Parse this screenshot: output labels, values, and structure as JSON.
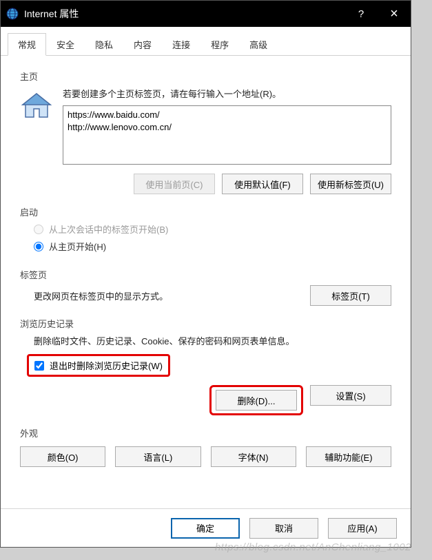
{
  "titlebar": {
    "title": "Internet 属性",
    "help": "?",
    "close": "×"
  },
  "tabs": [
    "常规",
    "安全",
    "隐私",
    "内容",
    "连接",
    "程序",
    "高级"
  ],
  "active_tab": 0,
  "homepage": {
    "label": "主页",
    "instruction": "若要创建多个主页标签页，请在每行输入一个地址(R)。",
    "urls": "https://www.baidu.com/\nhttp://www.lenovo.com.cn/",
    "btn_current": "使用当前页(C)",
    "btn_default": "使用默认值(F)",
    "btn_newtab": "使用新标签页(U)"
  },
  "startup": {
    "label": "启动",
    "opt_last": "从上次会话中的标签页开始(B)",
    "opt_home": "从主页开始(H)",
    "selected": "home"
  },
  "tabs_section": {
    "label": "标签页",
    "text": "更改网页在标签页中的显示方式。",
    "btn": "标签页(T)"
  },
  "history": {
    "label": "浏览历史记录",
    "text": "删除临时文件、历史记录、Cookie、保存的密码和网页表单信息。",
    "chk_delete_on_exit": "退出时删除浏览历史记录(W)",
    "chk_checked": true,
    "btn_delete": "删除(D)...",
    "btn_settings": "设置(S)"
  },
  "appearance": {
    "label": "外观",
    "btn_colors": "颜色(O)",
    "btn_lang": "语言(L)",
    "btn_fonts": "字体(N)",
    "btn_access": "辅助功能(E)"
  },
  "footer": {
    "ok": "确定",
    "cancel": "取消",
    "apply": "应用(A)"
  },
  "watermark": "https://blog.csdn.net/AnChenliang_1002"
}
